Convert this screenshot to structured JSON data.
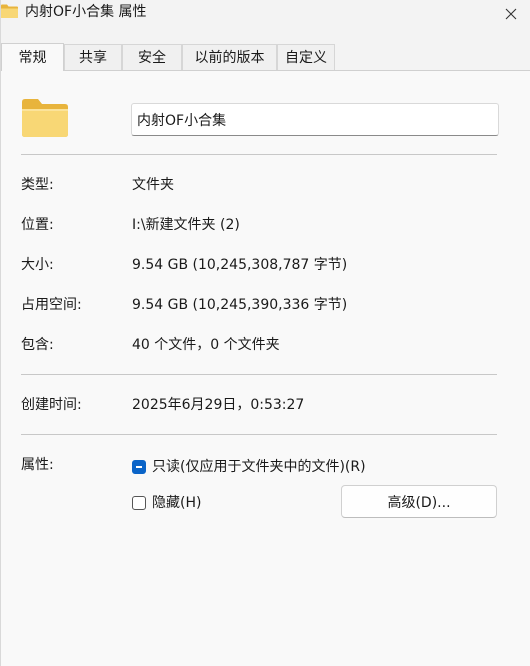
{
  "window": {
    "title": "内射OF小合集 属性"
  },
  "tabs": [
    {
      "label": "常规",
      "active": true
    },
    {
      "label": "共享",
      "active": false
    },
    {
      "label": "安全",
      "active": false
    },
    {
      "label": "以前的版本",
      "active": false
    },
    {
      "label": "自定义",
      "active": false
    }
  ],
  "general": {
    "folder_name": "内射OF小合集",
    "rows": [
      {
        "label": "类型:",
        "value": "文件夹"
      },
      {
        "label": "位置:",
        "value": "I:\\新建文件夹 (2)"
      },
      {
        "label": "大小:",
        "value": "9.54 GB (10,245,308,787 字节)"
      },
      {
        "label": "占用空间:",
        "value": "9.54 GB (10,245,390,336 字节)"
      },
      {
        "label": "包含:",
        "value": "40 个文件，0 个文件夹"
      }
    ],
    "created": {
      "label": "创建时间:",
      "value": "2025年6月29日，0:53:27"
    },
    "attributes": {
      "label": "属性:",
      "readonly_label": "只读(仅应用于文件夹中的文件)(R)",
      "readonly_state": "indeterminate",
      "hidden_label": "隐藏(H)",
      "hidden_state": "unchecked",
      "advanced_button": "高级(D)..."
    }
  },
  "colors": {
    "accent": "#0a64c8",
    "folder_front": "#f8d775",
    "folder_back": "#e8b43c"
  }
}
